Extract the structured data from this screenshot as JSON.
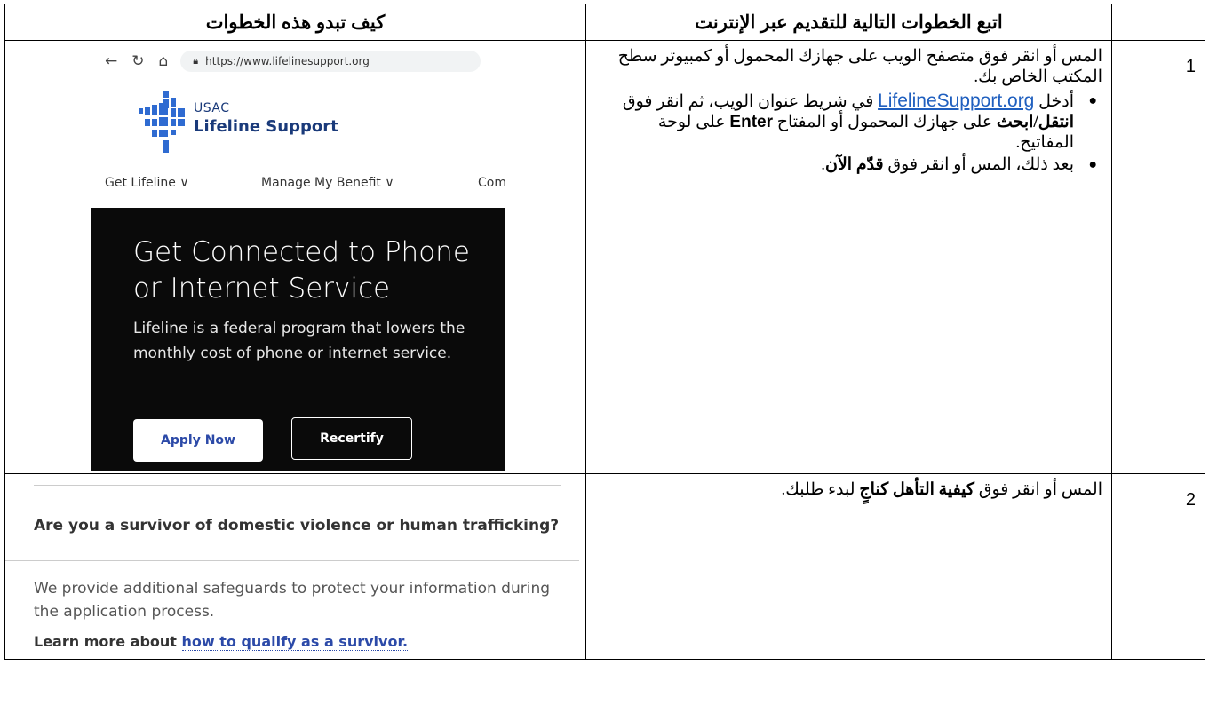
{
  "headers": {
    "visual": "كيف تبدو هذه الخطوات",
    "steps": "اتبع الخطوات التالية للتقديم عبر الإنترنت"
  },
  "rows": [
    {
      "number": "1",
      "intro": "المس أو انقر فوق متصفح الويب على جهازك المحمول أو كمبيوتر سطح المكتب الخاص بك.",
      "bullet1_pre": "أدخل",
      "bullet1_link": "LifelineSupport.org",
      "bullet1_mid": "في شريط عنوان الويب، ثم انقر فوق",
      "bullet1_bold1": "انتقل/ابحث",
      "bullet1_mid2": "على جهازك المحمول أو المفتاح",
      "bullet1_bold2": "Enter",
      "bullet1_end": "على لوحة المفاتيح.",
      "bullet2_pre": "بعد ذلك، المس أو انقر فوق",
      "bullet2_bold": "قدّم الآن",
      "bullet2_end": "."
    },
    {
      "number": "2",
      "pre": "المس أو انقر فوق",
      "bold": "كيفية التأهل كناجٍ",
      "end": "لبدء طلبك."
    }
  ],
  "screenshot1": {
    "url": "https://www.lifelinesupport.org",
    "org": "USAC",
    "site_name": "Lifeline Support",
    "nav": [
      "Get Lifeline ∨",
      "Manage My Benefit ∨",
      "Com"
    ],
    "hero_title": "Get Connected to Phone or Internet Service",
    "hero_text": "Lifeline is a federal program that lowers the monthly cost of phone or internet service.",
    "apply_label": "Apply Now",
    "recertify_label": "Recertify"
  },
  "screenshot2": {
    "question": "Are you a survivor of domestic violence or human trafficking?",
    "text": "We provide additional safeguards to protect your information during the application process.",
    "learn_prefix": "Learn more about",
    "learn_link": "how to qualify as a survivor."
  },
  "colors": {
    "link": "#1f5fbf",
    "brand": "#1a3a7a",
    "hero_bg": "#0a0a0a"
  }
}
